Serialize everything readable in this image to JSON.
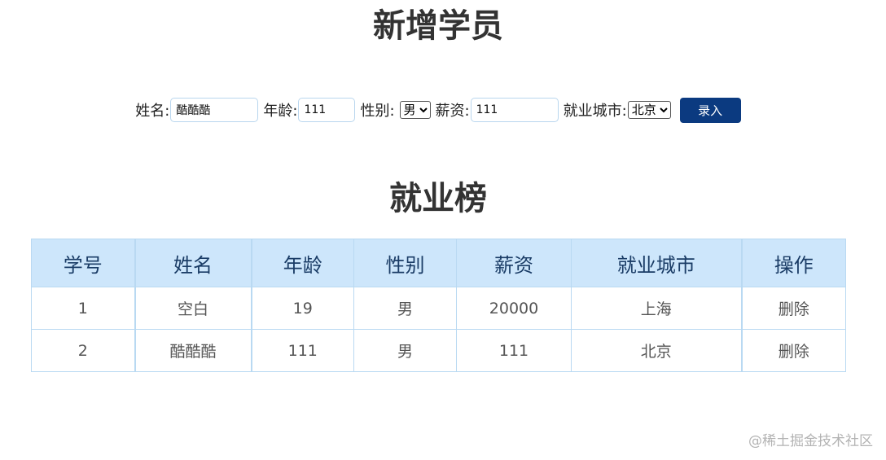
{
  "form": {
    "title": "新增学员",
    "name_label": "姓名:",
    "name_value": "酷酷酷",
    "age_label": "年龄:",
    "age_value": "111",
    "gender_label": "性别:",
    "gender_selected": "男",
    "salary_label": "薪资:",
    "salary_value": "111",
    "city_label": "就业城市:",
    "city_selected": "北京",
    "submit_label": "录入"
  },
  "ranking": {
    "title": "就业榜",
    "columns": [
      "学号",
      "姓名",
      "年龄",
      "性别",
      "薪资",
      "就业城市",
      "操作"
    ],
    "rows": [
      {
        "id": "1",
        "name": "空白",
        "age": "19",
        "gender": "男",
        "salary": "20000",
        "city": "上海",
        "action": "删除"
      },
      {
        "id": "2",
        "name": "酷酷酷",
        "age": "111",
        "gender": "男",
        "salary": "111",
        "city": "北京",
        "action": "删除"
      }
    ]
  },
  "watermark": "@稀土掘金技术社区"
}
